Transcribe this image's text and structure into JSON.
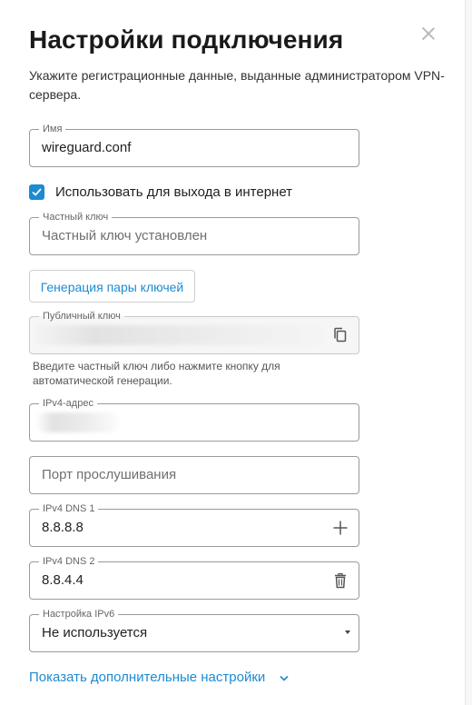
{
  "dialog": {
    "title": "Настройки подключения",
    "subtitle": "Укажите регистрационные данные, выданные администратором VPN-сервера.",
    "close_icon": "close-icon"
  },
  "name_field": {
    "label": "Имя",
    "value": "wireguard.conf"
  },
  "internet_checkbox": {
    "label": "Использовать для выхода в интернет",
    "checked": true
  },
  "private_key": {
    "label": "Частный ключ",
    "placeholder": "Частный ключ установлен"
  },
  "generate_button": {
    "label": "Генерация пары ключей"
  },
  "public_key": {
    "label": "Публичный ключ",
    "copy_icon": "copy-icon"
  },
  "public_key_hint": "Введите частный ключ либо нажмите кнопку для автоматической генерации.",
  "ipv4_address": {
    "label": "IPv4-адрес"
  },
  "listen_port": {
    "placeholder": "Порт прослушивания"
  },
  "dns1": {
    "label": "IPv4 DNS 1",
    "value": "8.8.8.8",
    "icon": "plus-icon"
  },
  "dns2": {
    "label": "IPv4 DNS 2",
    "value": "8.8.4.4",
    "icon": "trash-icon"
  },
  "ipv6": {
    "label": "Настройка IPv6",
    "value": "Не используется"
  },
  "more_settings": {
    "label": "Показать дополнительные настройки"
  },
  "colors": {
    "accent": "#1c8bd1",
    "border": "#9a9a9a",
    "text": "#1f1f1f"
  }
}
